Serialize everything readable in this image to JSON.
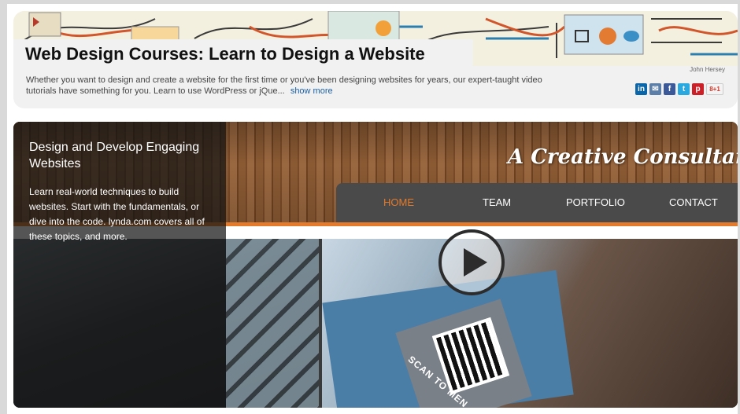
{
  "header": {
    "title": "Web Design Courses: Learn to Design a Website",
    "author": "John Hersey",
    "description": "Whether you want to design and create a website for the first time or you've been designing websites for years, our expert-taught video tutorials have something for you. Learn to use WordPress or jQue...",
    "show_more": "show more",
    "share": [
      {
        "icon": "linkedin-icon",
        "glyph": "in",
        "color": "#0a66a8"
      },
      {
        "icon": "email-icon",
        "glyph": "✉",
        "color": "#5b7fa8"
      },
      {
        "icon": "facebook-icon",
        "glyph": "f",
        "color": "#3b5998"
      },
      {
        "icon": "twitter-icon",
        "glyph": "t",
        "color": "#2aa9e0"
      },
      {
        "icon": "pinterest-icon",
        "glyph": "p",
        "color": "#cb2027"
      },
      {
        "icon": "googleplus-icon",
        "glyph": "8+1",
        "color": "#e8e8e8"
      }
    ]
  },
  "hero": {
    "overlay_title": "Design and Develop Engaging Websites",
    "overlay_text": "Learn real-world techniques to build websites. Start with the fundamentals, or dive into the code. lynda.com covers all of these topics, and more.",
    "logo_text": "A Creative Consultancy",
    "nav": [
      "HOME",
      "TEAM",
      "PORTFOLIO",
      "CONTACT"
    ],
    "nav_active_color": "#e37a2c",
    "scan_text": "SCAN TO MEN"
  }
}
